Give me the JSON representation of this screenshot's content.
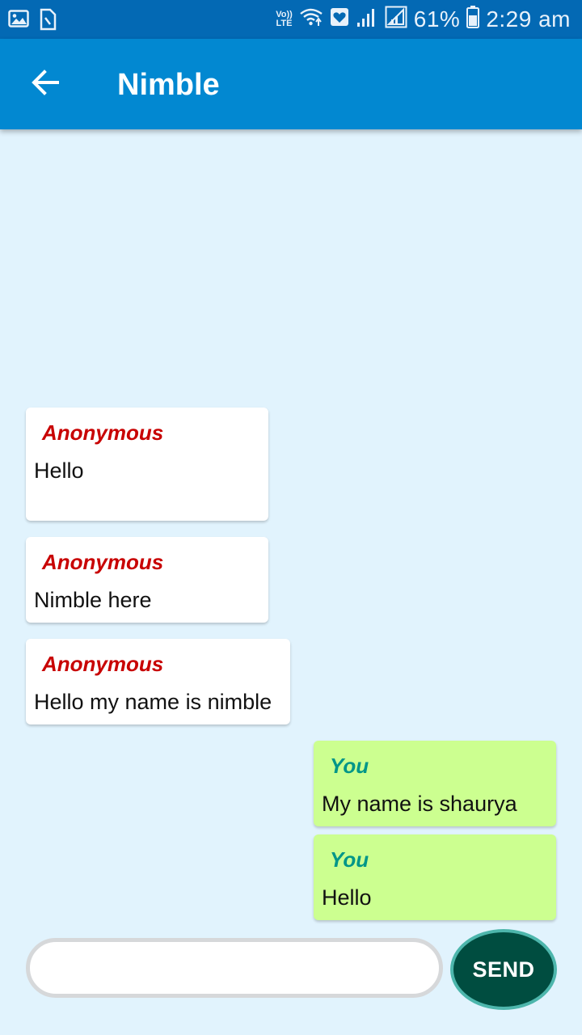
{
  "status_bar": {
    "volte_top": "Vo))",
    "volte_bottom": "LTE",
    "battery_percent": "61%",
    "time": "2:29 am",
    "icons": [
      "image-icon",
      "sim-card-icon",
      "volte-icon",
      "wifi-icon",
      "heart-app-icon",
      "signal-icon",
      "signal-icon-2",
      "battery-icon"
    ]
  },
  "app_bar": {
    "title": "Nimble",
    "back_icon": "arrow-left-icon"
  },
  "messages": [
    {
      "sender": "Anonymous",
      "text": "Hello"
    },
    {
      "sender": "Anonymous",
      "text": "Nimble here"
    },
    {
      "sender": "Anonymous",
      "text": "Hello my name is nimble"
    },
    {
      "sender": "You",
      "text": "My name is shaurya"
    },
    {
      "sender": "You",
      "text": "Hello"
    }
  ],
  "composer": {
    "input_value": "",
    "send_label": "SEND"
  },
  "colors": {
    "status_bar": "#0369b4",
    "app_bar": "#0288d1",
    "background": "#e1f3fd",
    "incoming_bubble": "#ffffff",
    "outgoing_bubble": "#ccff90",
    "incoming_sender": "#c80000",
    "outgoing_sender": "#009688",
    "send_button": "#004d40"
  }
}
